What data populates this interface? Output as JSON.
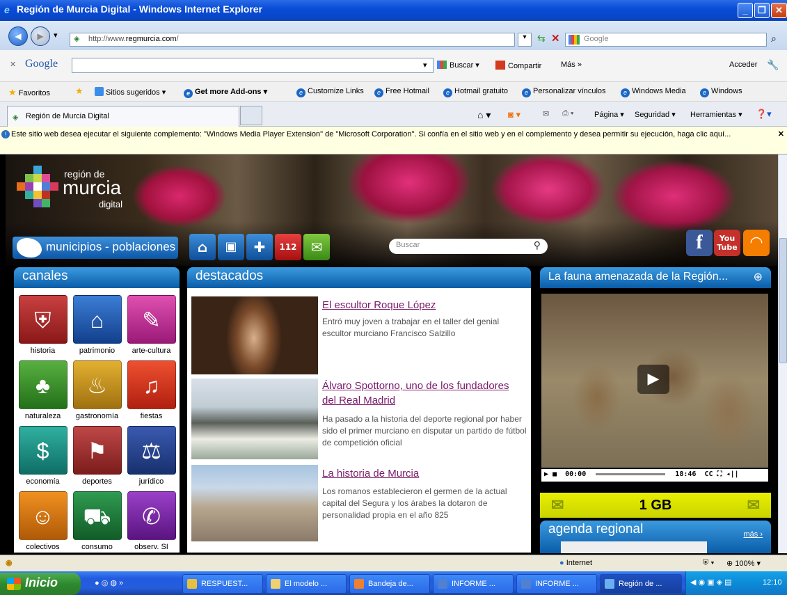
{
  "window": {
    "title": "Región de Murcia Digital - Windows Internet Explorer"
  },
  "address": {
    "url_prefix": "http://www.",
    "url_domain": "regmurcia.com",
    "url_suffix": "/",
    "search_placeholder": "Google"
  },
  "googlebar": {
    "label": "Google",
    "buscar": "Buscar",
    "compartir": "Compartir",
    "mas": "Más »",
    "acceder": "Acceder"
  },
  "favorites": {
    "favoritos": "Favoritos",
    "items": [
      "Sitios sugeridos ▾",
      "Get more Add-ons ▾",
      "Customize Links",
      "Free Hotmail",
      "Hotmail gratuito",
      "Personalizar vínculos",
      "Windows Media",
      "Windows"
    ]
  },
  "tab": {
    "title": "Región de Murcia Digital",
    "pagina": "Página ▾",
    "seguridad": "Seguridad ▾",
    "herramientas": "Herramientas ▾"
  },
  "infobar": {
    "text": "Este sitio web desea ejecutar el siguiente complemento: \"Windows Media Player Extension\" de \"Microsoft Corporation\". Si confía en el sitio web y en el complemento y desea permitir su ejecución, haga clic aquí..."
  },
  "site": {
    "logo": {
      "line1": "región de",
      "line2": "murcia",
      "line3": "digital"
    },
    "municipios": "municipios - poblaciones",
    "search_placeholder": "Buscar",
    "canales_title": "canales",
    "categories": [
      "historia",
      "patrimonio",
      "arte-cultura",
      "naturaleza",
      "gastronomía",
      "fiestas",
      "economía",
      "deportes",
      "jurídico",
      "colectivos",
      "consumo",
      "observ. SI"
    ],
    "destacados_title": "destacados",
    "articles": [
      {
        "title": "El escultor Roque López",
        "text": "Entró muy joven a trabajar en el taller del genial escultor murciano Francisco Salzillo"
      },
      {
        "title": "Álvaro Spottorno, uno de los fundadores del Real Madrid",
        "text": "Ha pasado a la historia del deporte regional por haber sido el primer murciano en disputar un partido de fútbol de competición oficial"
      },
      {
        "title": "La historia de Murcia",
        "text": "Los romanos establecieron el germen de la actual capital del Segura y los árabes la dotaron de personalidad propia en el año 825"
      }
    ],
    "video_title": "La fauna amenazada de la Región...",
    "video_time_start": "00:00",
    "video_time_end": "18:46",
    "gb_label": "1 GB",
    "agenda_title": "agenda regional",
    "agenda_more": "más ›"
  },
  "status": {
    "zone": "Internet",
    "zoom": "100%"
  },
  "taskbar": {
    "start": "Inicio",
    "tasks": [
      "RESPUEST...",
      "El modelo ...",
      "Bandeja de...",
      "INFORME ...",
      "INFORME ...",
      "Región de ..."
    ],
    "clock": "12:10"
  }
}
